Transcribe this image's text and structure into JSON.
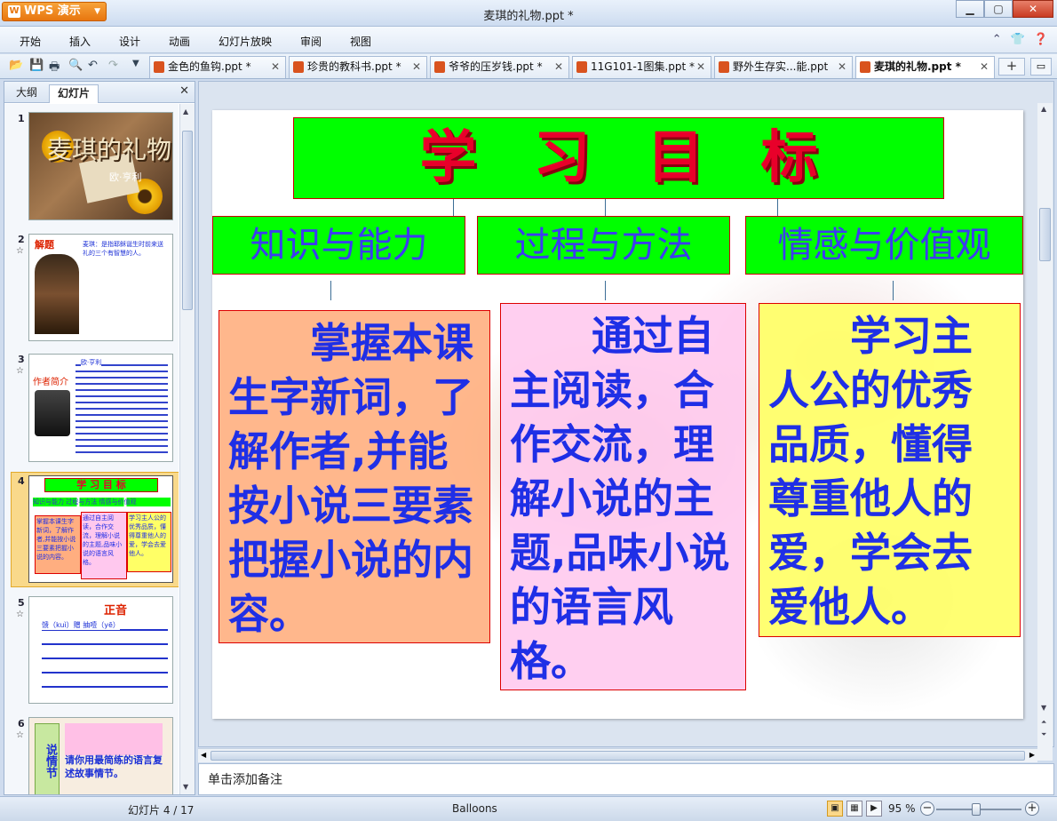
{
  "app": {
    "button_label": "WPS 演示",
    "window_title": "麦琪的礼物.ppt *",
    "window_controls": [
      "minimize-icon",
      "maximize-icon",
      "close-icon"
    ]
  },
  "menu": {
    "items": [
      "开始",
      "插入",
      "设计",
      "动画",
      "幻灯片放映",
      "审阅",
      "视图"
    ],
    "right_icons": [
      "collapse-ribbon-icon",
      "skin-icon",
      "help-icon"
    ]
  },
  "doc_tabs": [
    {
      "label": "金色的鱼钩.ppt *",
      "active": false
    },
    {
      "label": "珍贵的教科书.ppt *",
      "active": false
    },
    {
      "label": "爷爷的压岁钱.ppt *",
      "active": false
    },
    {
      "label": "11G101-1图集.ppt *",
      "active": false
    },
    {
      "label": "野外生存实...能.ppt",
      "active": false
    },
    {
      "label": "麦琪的礼物.ppt *",
      "active": true
    }
  ],
  "left_panel": {
    "tabs": [
      "大纲",
      "幻灯片"
    ],
    "active_tab": "幻灯片",
    "thumbnails": [
      {
        "number": "1",
        "title": "麦琪的礼物",
        "sub": "欧·亨利"
      },
      {
        "number": "2",
        "title": "解题",
        "sub": "麦琪：是指耶稣诞生时前来送礼的三个有智慧的人。"
      },
      {
        "number": "3",
        "title": "作者简介",
        "sub": "欧·亨利"
      },
      {
        "number": "4",
        "title": "学 习 目 标",
        "sub": "知识与能力 过程与方法 情感与价值观"
      },
      {
        "number": "5",
        "title": "正音",
        "sub": "馈（kuì）赠 抽噎（yē）"
      },
      {
        "number": "6",
        "title": "说情节",
        "sub": "请你用最简练的语言复述故事情节。"
      }
    ]
  },
  "slide": {
    "title": "学　习　目　标",
    "subtitles": [
      "知识与能力",
      "过程与方法",
      "情感与价值观"
    ],
    "contents": [
      "掌握本课生字新词，了解作者,并能按小说三要素把握小说的内容。",
      "通过自主阅读，合作交流，理解小说的主题,品味小说的语言风格。",
      "学习主人公的优秀品质，懂得尊重他人的爱，学会去爱他人。"
    ],
    "colors": {
      "title_bg": "#00ff00",
      "title_text": "#e8002a",
      "subtitle_text": "#3c3cf0",
      "content_text": "#1f2fe6",
      "box1_bg": "#ffae80",
      "box2_bg": "#ffc8ee",
      "box3_bg": "#ffff66"
    }
  },
  "notes": {
    "placeholder": "单击添加备注"
  },
  "status": {
    "slide_indicator": "幻灯片 4 / 17",
    "theme": "Balloons",
    "zoom": "95 %",
    "zoom_value": 95
  }
}
